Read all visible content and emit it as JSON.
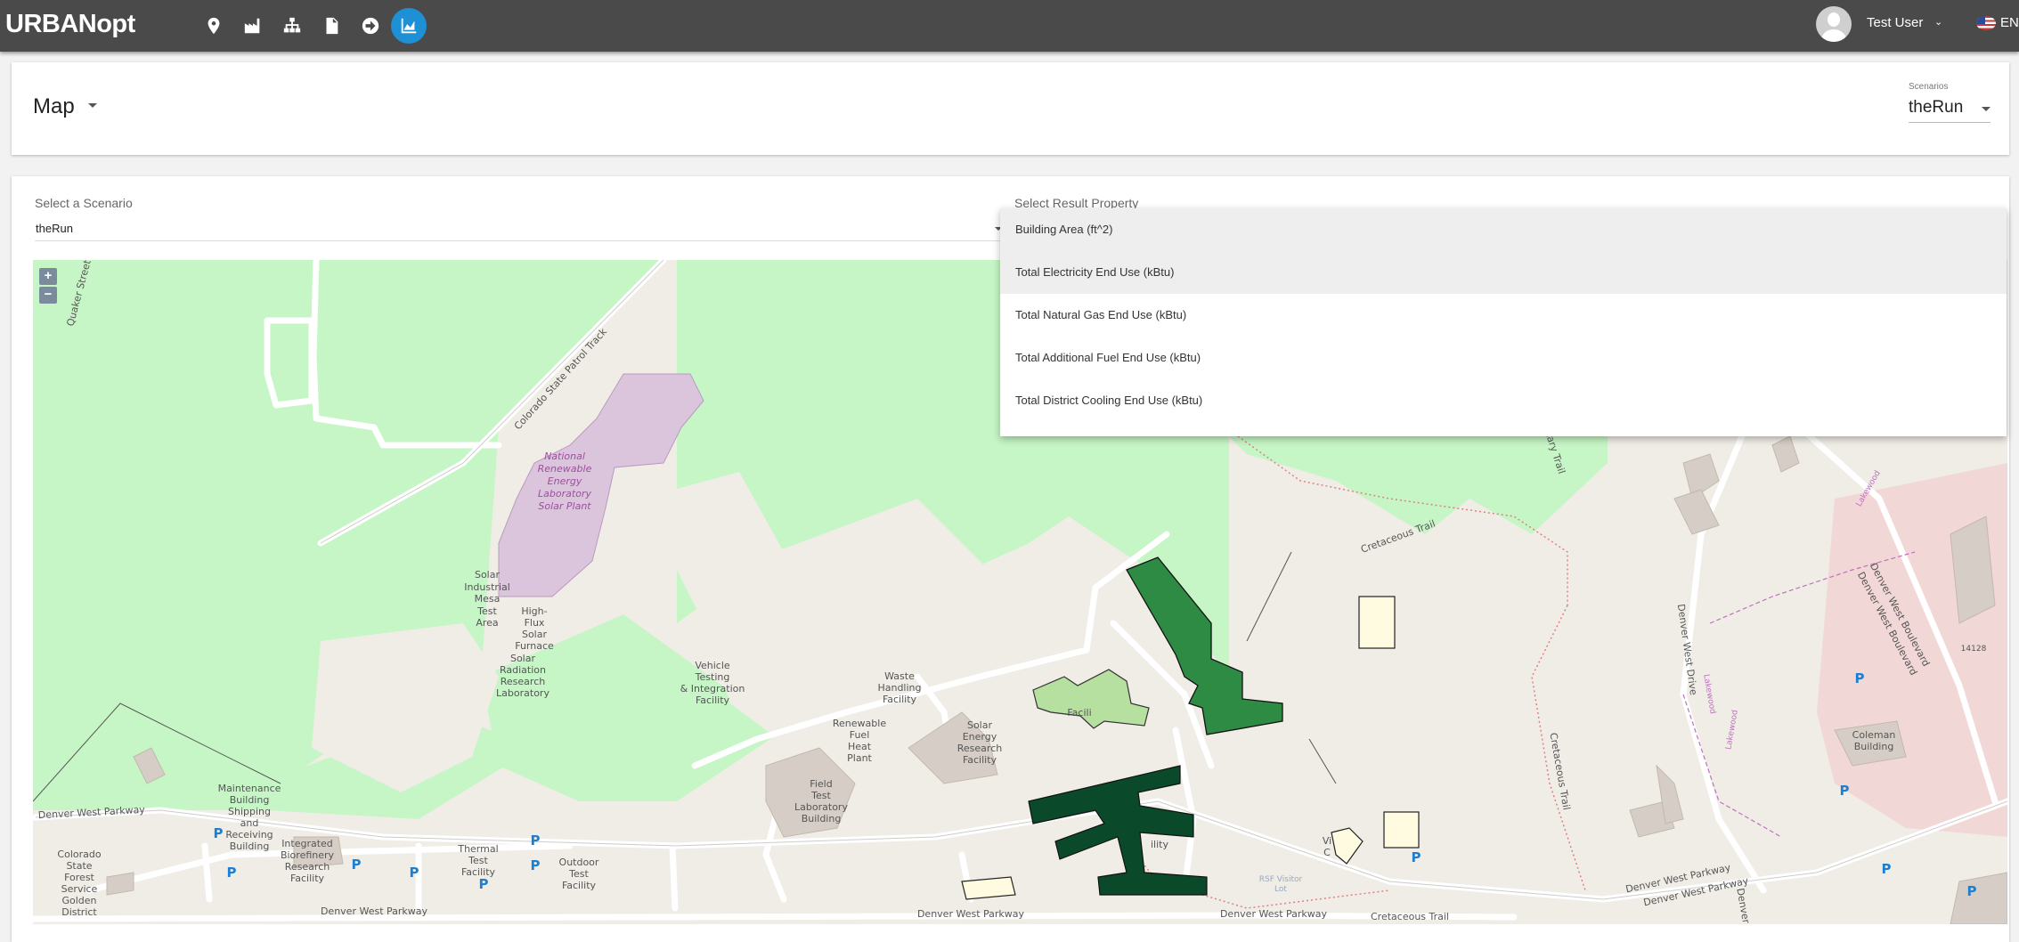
{
  "app": {
    "logo": "URBANopt"
  },
  "nav_icons": [
    "map-marker-icon",
    "factory-icon",
    "sitemap-icon",
    "file-icon",
    "arrow-circle-right-icon",
    "chart-area-icon"
  ],
  "user": {
    "name": "Test User",
    "language": "EN"
  },
  "header": {
    "title": "Map",
    "scenarios_label": "Scenarios",
    "scenarios_value": "theRun"
  },
  "scenario_select": {
    "label": "Select a Scenario",
    "value": "theRun"
  },
  "result_property": {
    "label": "Select Result Property",
    "options": [
      "Building Area (ft^2)",
      "Total Electricity End Use (kBtu)",
      "Total Natural Gas End Use (kBtu)",
      "Total Additional Fuel End Use (kBtu)",
      "Total District Cooling End Use (kBtu)"
    ]
  },
  "map": {
    "zoom_in": "+",
    "zoom_out": "−",
    "labels": {
      "quaker": "Quaker Street",
      "colorado_track": "Colorado State Patrol Track",
      "nrel1": "National",
      "nrel2": "Renewable",
      "nrel3": "Energy",
      "nrel4": "Laboratory",
      "nrel5": "Solar Plant",
      "sim1": "Solar",
      "sim2": "Industrial",
      "sim3": "Mesa",
      "sim4": "Test",
      "sim5": "Area",
      "hff1": "High-",
      "hff2": "Flux",
      "hff3": "Solar",
      "hff4": "Furnace",
      "srr1": "Solar",
      "srr2": "Radiation",
      "srr3": "Research",
      "srr4": "Laboratory",
      "vt1": "Vehicle",
      "vt2": "Testing",
      "vt3": "& Integration",
      "vt4": "Facility",
      "wh1": "Waste",
      "wh2": "Handling",
      "wh3": "Facility",
      "rf1": "Renewable",
      "rf2": "Fuel",
      "rf3": "Heat",
      "rf4": "Plant",
      "se1": "Solar",
      "se2": "Energy",
      "se3": "Research",
      "se4": "Facility",
      "ft1": "Field",
      "ft2": "Test",
      "ft3": "Laboratory",
      "ft4": "Building",
      "facil": "Facili",
      "mb1": "Maintenance",
      "mb2": "Building",
      "mb3": "Shipping",
      "mb4": "and",
      "mb5": "Receiving",
      "mb6": "Building",
      "ib1": "Integrated",
      "ib2": "Biorefinery",
      "ib3": "Research",
      "ib4": "Facility",
      "tt1": "Thermal",
      "tt2": "Test",
      "tt3": "Facility",
      "ot1": "Outdoor",
      "ot2": "Test",
      "ot3": "Facility",
      "cs1": "Colorado",
      "cs2": "State",
      "cs3": "Forest",
      "cs4": "Service",
      "cs5": "Golden",
      "cs6": "District",
      "dwp1": "Denver West Parkway",
      "dwp2": "Denver West Parkway",
      "dwp3": "Denver West Parkway",
      "dwp4": "Denver West Parkway",
      "dwp5": "Denver West Parkway",
      "dwp6": "Denver West Parkway",
      "ct1": "Cretaceous Trail",
      "ct2": "Cretaceous Trail",
      "ct3": "Cretaceous Trail",
      "tary": "tary Trail",
      "dwd": "Denver West Drive",
      "dwb1": "Denver West Boulevard",
      "dwb2": "Denver West Boulevard",
      "lakewood1": "Lakewood",
      "lakewood2": "Lakewood",
      "lakewood3": "Lakewood",
      "cb1": "Coleman",
      "cb2": "Building",
      "n14128": "14128",
      "vi1": "Vi",
      "vi2": "C",
      "rsf1": "RSF Visitor",
      "rsf2": "Lot",
      "ility": "ility",
      "p": "P",
      "dw_side": "Denver W"
    }
  }
}
